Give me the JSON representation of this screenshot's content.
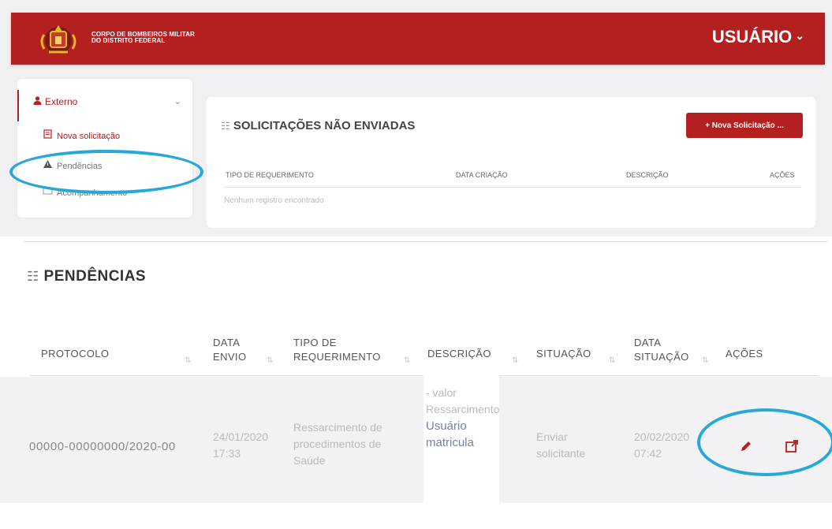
{
  "header": {
    "org_line1": "CORPO DE BOMBEIROS MILITAR",
    "org_line2": "DO DISTRITO FEDERAL",
    "user_label": "USUÁRIO",
    "logo_icon": "cbmdf-emblem-icon",
    "chevron_icon": "chevron-down-icon",
    "brand_color": "#b3201f"
  },
  "sidebar": {
    "group_label": "Externo",
    "group_icon": "user-icon",
    "items": [
      {
        "label": "Nova solicitação",
        "icon": "new-document-icon"
      },
      {
        "label": "Pendências",
        "icon": "warning-icon"
      },
      {
        "label": "Acompanhamento",
        "icon": "folder-icon"
      }
    ]
  },
  "unsent": {
    "title": "SOLICITAÇÕES NÃO ENVIADAS",
    "button_label": "+ Nova Solicitação ...",
    "columns": [
      "TIPO DE REQUERIMENTO",
      "DATA CRIAÇÃO",
      "DESCRIÇÃO",
      "AÇÕES"
    ],
    "empty_message": "Nenhum registro encontrado"
  },
  "pendencias": {
    "title": "PENDÊNCIAS",
    "columns": {
      "protocolo": "PROTOCOLO",
      "data_envio_1": "DATA",
      "data_envio_2": "ENVIO",
      "tipo_1": "TIPO DE",
      "tipo_2": "REQUERIMENTO",
      "descricao": "DESCRIÇÃO",
      "situacao": "SITUAÇÃO",
      "data_situacao_1": "DATA",
      "data_situacao_2": "SITUAÇÃO",
      "acoes": "AÇÕES"
    },
    "row": {
      "protocolo": "00000-00000000/2020-00",
      "data_envio_1": "24/01/2020",
      "data_envio_2": "17:33",
      "tipo_1": "Ressarcimento de",
      "tipo_2": "procedimentos de",
      "tipo_3": "Saúde",
      "desc_1": "- valor",
      "desc_2": "Ressarcimento",
      "desc_3": "Usuário",
      "desc_4": "matricula",
      "situacao_1": "Enviar",
      "situacao_2": "solicitante",
      "data_situacao_1": "20/02/2020",
      "data_situacao_2": "07:42",
      "actions": [
        "pencil-icon",
        "external-link-icon"
      ]
    }
  },
  "highlight_color": "#27a8d8"
}
